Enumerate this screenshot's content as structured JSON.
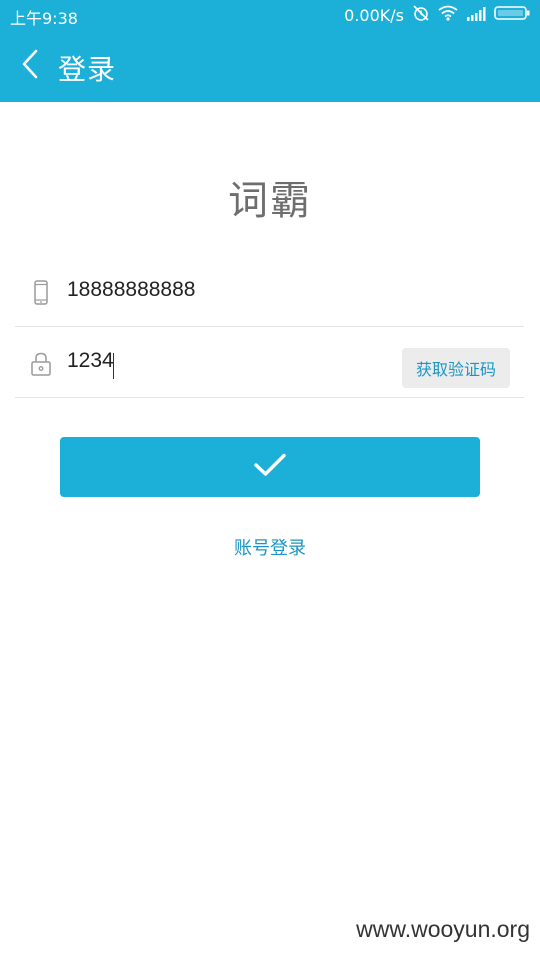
{
  "status_bar": {
    "time": "上午9:38",
    "net_speed": "0.00K/s",
    "icons": [
      "alarm-off-icon",
      "wifi-icon",
      "signal-icon",
      "battery-icon"
    ]
  },
  "toolbar": {
    "title": "登录"
  },
  "app": {
    "name": "词霸"
  },
  "form": {
    "phone_value": "18888888888",
    "code_value": "1234",
    "get_code_label": "获取验证码"
  },
  "alt_login_label": "账号登录",
  "watermark": "www.wooyun.org",
  "colors": {
    "primary": "#1cb0d9",
    "link": "#1b96c4"
  }
}
